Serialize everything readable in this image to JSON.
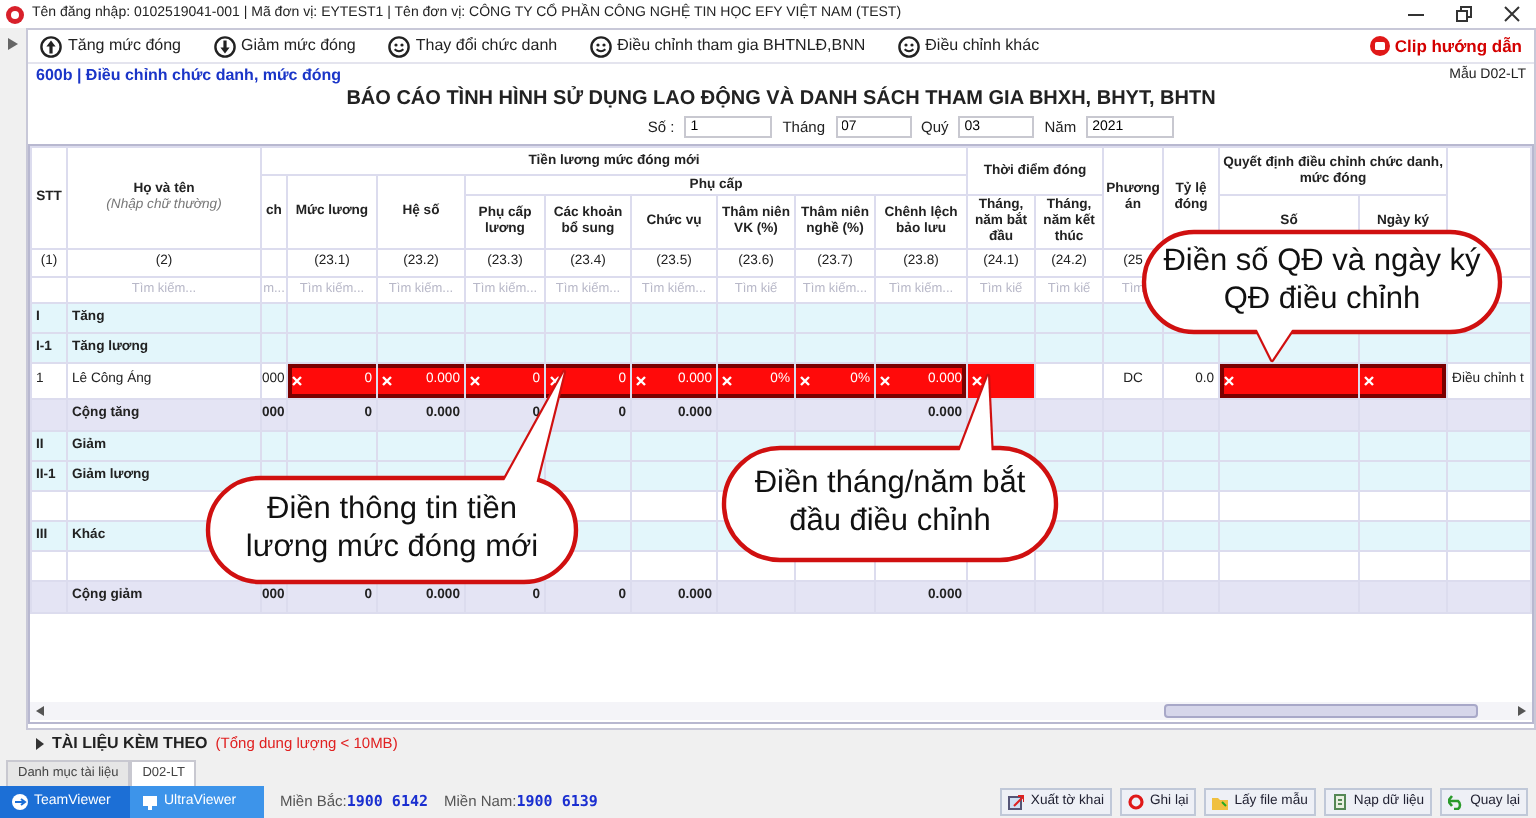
{
  "window": {
    "title": "Tên đăng nhập: 0102519041-001 | Mã đơn vị: EYTEST1 | Tên đơn vị: CÔNG TY CỔ PHẦN CÔNG NGHỆ TIN HỌC EFY VIỆT NAM (TEST)"
  },
  "toolbar": {
    "items": [
      {
        "label": "Tăng mức đóng",
        "kind": "up"
      },
      {
        "label": "Giảm mức đóng",
        "kind": "down"
      },
      {
        "label": "Thay đổi chức danh",
        "kind": "smiley"
      },
      {
        "label": "Điều chỉnh tham gia BHTNLĐ,BNN",
        "kind": "smiley"
      },
      {
        "label": "Điều chỉnh khác",
        "kind": "smiley"
      }
    ],
    "help_link": "Clip hướng dẫn"
  },
  "form": {
    "breadcrumb": "600b | Điều chỉnh chức danh, mức đóng",
    "template": "Mẫu D02-LT",
    "title": "BÁO CÁO TÌNH HÌNH SỬ DỤNG LAO ĐỘNG VÀ DANH SÁCH THAM GIA BHXH, BHYT, BHTN",
    "fields": [
      {
        "label": "Số :",
        "value": "1"
      },
      {
        "label": "Tháng",
        "value": "07"
      },
      {
        "label": "Quý",
        "value": "03"
      },
      {
        "label": "Năm",
        "value": "2021"
      }
    ]
  },
  "table": {
    "columns": [
      {
        "label": "STT",
        "number": "(1)"
      },
      {
        "label": "Họ và tên",
        "hint": "(Nhập chữ thường)",
        "number": "(2)",
        "placeholder": "Tìm kiếm..."
      },
      {
        "label": "Tiền lương mức đóng mới",
        "children": [
          {
            "label": "ch",
            "placeholder": "m..."
          },
          {
            "label": "Mức lương",
            "number": "(23.1)",
            "placeholder": "Tìm kiếm..."
          },
          {
            "label": "Hệ số",
            "number": "(23.2)",
            "placeholder": "Tìm kiếm..."
          },
          {
            "label": "Phụ cấp",
            "children": [
              {
                "label": "Phụ cấp lương",
                "number": "(23.3)",
                "placeholder": "Tìm kiếm..."
              },
              {
                "label": "Các khoản bổ sung",
                "number": "(23.4)",
                "placeholder": "Tìm kiếm..."
              },
              {
                "label": "Chức vụ",
                "number": "(23.5)",
                "placeholder": "Tìm kiếm..."
              },
              {
                "label": "Thâm niên VK (%)",
                "number": "(23.6)",
                "placeholder": "Tìm kiế"
              },
              {
                "label": "Thâm niên nghề (%)",
                "number": "(23.7)",
                "placeholder": "Tìm kiếm..."
              },
              {
                "label": "Chênh lệch bảo lưu",
                "number": "(23.8)",
                "placeholder": "Tìm kiếm..."
              }
            ]
          }
        ]
      },
      {
        "label": "Thời điểm đóng",
        "children": [
          {
            "label": "Tháng, năm bắt đầu",
            "number": "(24.1)",
            "placeholder": "Tìm kiế"
          },
          {
            "label": "Tháng, năm kết thúc",
            "number": "(24.2)",
            "placeholder": "Tìm kiế"
          }
        ]
      },
      {
        "label": "Phương án",
        "number": "(25",
        "placeholder": "Tìm"
      },
      {
        "label": "Tỷ lệ đóng"
      },
      {
        "label": "Quyết định điều chỉnh chức danh, mức đóng",
        "children": [
          {
            "label": "Số"
          },
          {
            "label": "Ngày ký"
          }
        ]
      },
      {}
    ],
    "rows": [
      {
        "kind": "group",
        "stt": "I",
        "name": "Tăng"
      },
      {
        "kind": "group",
        "stt": "I-1",
        "name": "Tăng lương"
      },
      {
        "kind": "data",
        "stt": "1",
        "name": "Lê Công Áng",
        "cells": [
          "000",
          {
            "highlighted": true,
            "frame": true,
            "text": "0"
          },
          {
            "highlighted": true,
            "frame": true,
            "text": "0.000"
          },
          {
            "highlighted": true,
            "frame": true,
            "text": "0"
          },
          {
            "highlighted": true,
            "frame": true,
            "text": "0"
          },
          {
            "highlighted": true,
            "frame": true,
            "text": "0.000"
          },
          {
            "highlighted": true,
            "frame": true,
            "text": "0%"
          },
          {
            "highlighted": true,
            "frame": true,
            "text": "0%"
          },
          {
            "highlighted": true,
            "frame": true,
            "text": "0.000"
          },
          {
            "highlighted": true,
            "frame": false
          },
          null,
          "DC",
          "0.0",
          {
            "highlighted": true,
            "frame": true
          },
          {
            "highlighted": true,
            "frame": true
          },
          "Điều chỉnh t"
        ]
      },
      {
        "kind": "total",
        "name": "Cộng tăng",
        "cells": [
          "000",
          "0",
          "0.000",
          "0",
          "0",
          "0.000",
          null,
          null,
          "0.000",
          null,
          null,
          null,
          null,
          null,
          null,
          null
        ]
      },
      {
        "kind": "group",
        "stt": "II",
        "name": "Giảm"
      },
      {
        "kind": "group",
        "stt": "II-1",
        "name": "Giảm lương"
      },
      {
        "kind": "blank"
      },
      {
        "kind": "group",
        "stt": "III",
        "name": "Khác"
      },
      {
        "kind": "blank"
      },
      {
        "kind": "total",
        "name": "Cộng giảm",
        "cells": [
          "000",
          "0",
          "0.000",
          "0",
          "0",
          "0.000",
          null,
          null,
          "0.000",
          null,
          null,
          null,
          null,
          null,
          null,
          null
        ]
      }
    ]
  },
  "callouts": [
    {
      "text": "Điền số QĐ và ngày ký QĐ điều chỉnh"
    },
    {
      "text": "Điền tháng/năm bắt đầu điều chỉnh"
    },
    {
      "text": "Điền thông tin tiền lương mức đóng mới"
    }
  ],
  "attachments": {
    "title": "TÀI LIỆU KÈM THEO",
    "note": "(Tổng dung lượng < 10MB)"
  },
  "tabs": [
    {
      "label": "Danh mục tài liệu",
      "selected": false
    },
    {
      "label": "D02-LT",
      "selected": true
    }
  ],
  "status_bar": {
    "apps": [
      {
        "label": "TeamViewer"
      },
      {
        "label": "UltraViewer"
      }
    ],
    "hotlines": [
      {
        "label": "Miền Bắc:",
        "number": "1900 6142"
      },
      {
        "label": "Miền Nam:",
        "number": "1900 6139"
      }
    ],
    "buttons": [
      {
        "label": "Xuất tờ khai",
        "kind": "export"
      },
      {
        "label": "Ghi lại",
        "kind": "save"
      },
      {
        "label": "Lấy file mẫu",
        "kind": "template"
      },
      {
        "label": "Nạp dữ liệu",
        "kind": "import"
      },
      {
        "label": "Quay lại",
        "kind": "back"
      }
    ]
  }
}
